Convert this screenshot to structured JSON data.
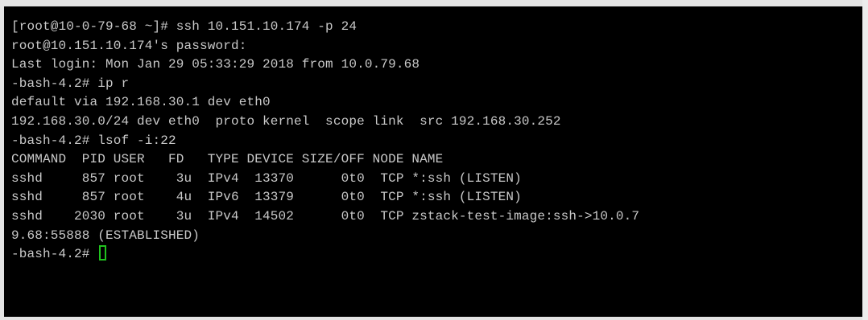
{
  "terminal": {
    "lines": [
      "[root@10-0-79-68 ~]# ssh 10.151.10.174 -p 24",
      "root@10.151.10.174's password:",
      "Last login: Mon Jan 29 05:33:29 2018 from 10.0.79.68",
      "-bash-4.2# ip r",
      "default via 192.168.30.1 dev eth0",
      "192.168.30.0/24 dev eth0  proto kernel  scope link  src 192.168.30.252",
      "-bash-4.2# lsof -i:22",
      "COMMAND  PID USER   FD   TYPE DEVICE SIZE/OFF NODE NAME",
      "sshd     857 root    3u  IPv4  13370      0t0  TCP *:ssh (LISTEN)",
      "sshd     857 root    4u  IPv6  13379      0t0  TCP *:ssh (LISTEN)",
      "sshd    2030 root    3u  IPv4  14502      0t0  TCP zstack-test-image:ssh->10.0.7",
      "9.68:55888 (ESTABLISHED)"
    ],
    "prompt": "-bash-4.2# ",
    "colors": {
      "background": "#000000",
      "foreground": "#c9c9c9",
      "cursor": "#21c21f"
    }
  }
}
